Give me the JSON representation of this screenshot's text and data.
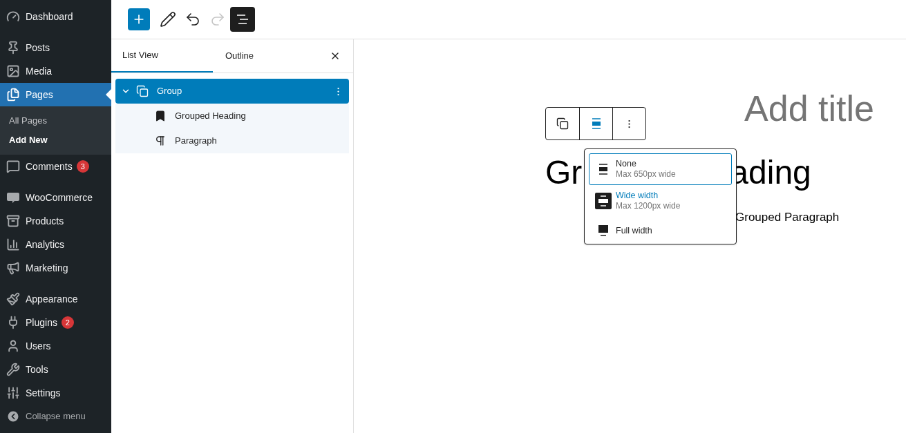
{
  "sidebar": {
    "sections": [
      [
        {
          "label": "Dashboard",
          "selected": false
        }
      ],
      [
        {
          "label": "Posts",
          "selected": false
        },
        {
          "label": "Media",
          "selected": false
        },
        {
          "label": "Pages",
          "selected": true,
          "children": [
            {
              "label": "All Pages",
              "selected": false
            },
            {
              "label": "Add New",
              "selected": true
            }
          ]
        },
        {
          "label": "Comments",
          "selected": false,
          "badge": "3"
        }
      ],
      [
        {
          "label": "WooCommerce",
          "selected": false
        },
        {
          "label": "Products",
          "selected": false
        },
        {
          "label": "Analytics",
          "selected": false
        },
        {
          "label": "Marketing",
          "selected": false
        }
      ],
      [
        {
          "label": "Appearance",
          "selected": false
        },
        {
          "label": "Plugins",
          "selected": false,
          "badge": "2"
        },
        {
          "label": "Users",
          "selected": false
        },
        {
          "label": "Tools",
          "selected": false
        },
        {
          "label": "Settings",
          "selected": false
        }
      ]
    ],
    "collapse": "Collapse menu"
  },
  "toolbar": {
    "buttons": [
      {
        "kind": "add",
        "selected": false,
        "disabled": false
      },
      {
        "kind": "tools",
        "selected": false,
        "disabled": false
      },
      {
        "kind": "undo",
        "selected": false,
        "disabled": false
      },
      {
        "kind": "redo",
        "selected": false,
        "disabled": true
      },
      {
        "kind": "list-view",
        "selected": true,
        "disabled": false
      }
    ]
  },
  "panel": {
    "tabs": [
      {
        "label": "List View",
        "selected": true
      },
      {
        "label": "Outline",
        "selected": false
      }
    ],
    "tree": [
      {
        "label": "Group",
        "kind": "group",
        "selected": true,
        "expanded": true,
        "children": [
          {
            "label": "Grouped Heading",
            "kind": "heading",
            "selected": false
          },
          {
            "label": "Paragraph",
            "kind": "paragraph",
            "selected": false
          }
        ]
      }
    ]
  },
  "canvas": {
    "title_placeholder": "Add title",
    "block_toolbar": [
      {
        "kind": "group",
        "selected": false
      },
      {
        "kind": "align",
        "selected": true
      },
      {
        "kind": "more",
        "selected": false
      }
    ],
    "align_menu": [
      {
        "label": "None",
        "note": "Max 650px wide",
        "kind": "none",
        "focused": true,
        "selected": false
      },
      {
        "label": "Wide width",
        "note": "Max 1200px wide",
        "kind": "wide",
        "focused": false,
        "selected": true
      },
      {
        "label": "Full width",
        "kind": "full",
        "focused": false,
        "selected": false
      }
    ],
    "heading_parts": [
      "Gr",
      "ading"
    ],
    "paragraph": "Grouped Paragraph"
  }
}
